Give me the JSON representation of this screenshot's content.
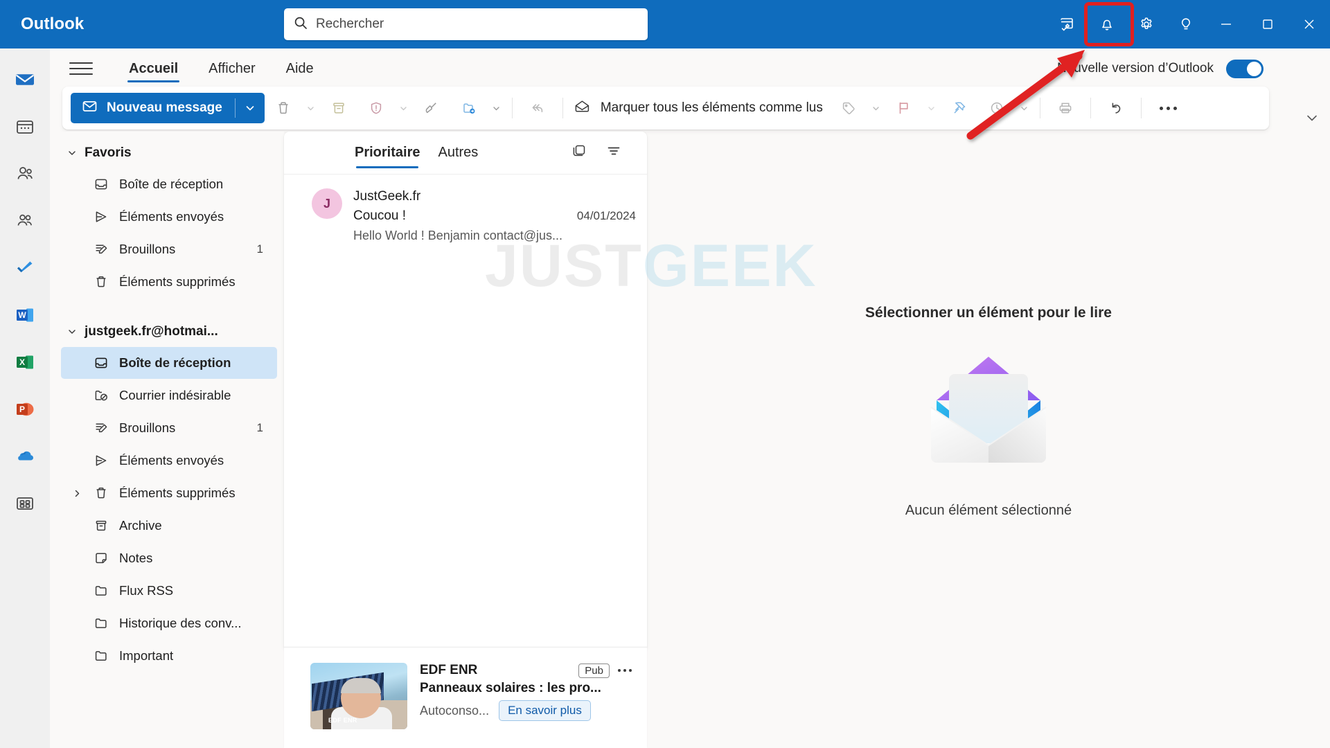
{
  "titlebar": {
    "brand": "Outlook",
    "search_placeholder": "Rechercher",
    "icons": [
      {
        "name": "todo-checkbox-icon",
        "label": "À faire"
      },
      {
        "name": "bell-icon",
        "label": "Notifications"
      },
      {
        "name": "gear-icon",
        "label": "Paramètres"
      },
      {
        "name": "lightbulb-icon",
        "label": "Conseils"
      }
    ],
    "window_controls": [
      "minimize",
      "maximize",
      "close"
    ],
    "highlight_color": "#e02020",
    "accent_color": "#0f6cbd"
  },
  "ribbon": {
    "tabs": [
      {
        "label": "Accueil",
        "active": true
      },
      {
        "label": "Afficher",
        "active": false
      },
      {
        "label": "Aide",
        "active": false
      }
    ],
    "new_version_label": "Nouvelle version d’Outlook",
    "new_version_on": true
  },
  "commandbar": {
    "new_message_label": "Nouveau message",
    "mark_all_read_label": "Marquer tous les éléments comme lus",
    "icons": [
      "delete-icon",
      "archive-icon",
      "report-icon",
      "sweep-icon",
      "move-to-icon",
      "reply-all-icon",
      "categorize-icon",
      "flag-icon",
      "pin-icon",
      "snooze-icon",
      "print-icon",
      "undo-icon",
      "more-options-icon"
    ]
  },
  "rail": {
    "items": [
      {
        "name": "mail-icon",
        "label": "Courrier",
        "active": true
      },
      {
        "name": "calendar-icon",
        "label": "Calendrier",
        "active": false
      },
      {
        "name": "people-icon",
        "label": "Contacts",
        "active": false
      },
      {
        "name": "groups-icon",
        "label": "Groupes",
        "active": false
      },
      {
        "name": "todo-icon",
        "label": "To Do",
        "active": false
      },
      {
        "name": "word-icon",
        "label": "Word",
        "active": false
      },
      {
        "name": "excel-icon",
        "label": "Excel",
        "active": false
      },
      {
        "name": "powerpoint-icon",
        "label": "PowerPoint",
        "active": false
      },
      {
        "name": "onedrive-icon",
        "label": "OneDrive",
        "active": false
      },
      {
        "name": "apps-icon",
        "label": "Applications",
        "active": false
      }
    ]
  },
  "folders": {
    "favorites": {
      "title": "Favoris",
      "items": [
        {
          "label": "Boîte de réception",
          "icon": "inbox-icon",
          "count": ""
        },
        {
          "label": "Éléments envoyés",
          "icon": "send-icon",
          "count": ""
        },
        {
          "label": "Brouillons",
          "icon": "draft-icon",
          "count": "1"
        },
        {
          "label": "Éléments supprimés",
          "icon": "trash-icon",
          "count": ""
        }
      ]
    },
    "account": {
      "title": "justgeek.fr@hotmai...",
      "items": [
        {
          "label": "Boîte de réception",
          "icon": "inbox-icon",
          "count": "",
          "selected": true,
          "twisty": false
        },
        {
          "label": "Courrier indésirable",
          "icon": "junk-icon",
          "count": "",
          "selected": false,
          "twisty": false
        },
        {
          "label": "Brouillons",
          "icon": "draft-icon",
          "count": "1",
          "selected": false,
          "twisty": false
        },
        {
          "label": "Éléments envoyés",
          "icon": "send-icon",
          "count": "",
          "selected": false,
          "twisty": false
        },
        {
          "label": "Éléments supprimés",
          "icon": "trash-icon",
          "count": "",
          "selected": false,
          "twisty": true
        },
        {
          "label": "Archive",
          "icon": "archive-icon",
          "count": "",
          "selected": false,
          "twisty": false
        },
        {
          "label": "Notes",
          "icon": "notes-icon",
          "count": "",
          "selected": false,
          "twisty": false
        },
        {
          "label": "Flux RSS",
          "icon": "folder-icon",
          "count": "",
          "selected": false,
          "twisty": false
        },
        {
          "label": "Historique des conv...",
          "icon": "folder-icon",
          "count": "",
          "selected": false,
          "twisty": false
        },
        {
          "label": "Important",
          "icon": "folder-icon",
          "count": "",
          "selected": false,
          "twisty": false
        }
      ]
    }
  },
  "message_list": {
    "tabs": [
      {
        "label": "Prioritaire",
        "active": true
      },
      {
        "label": "Autres",
        "active": false
      }
    ],
    "tools": [
      "conversation-view-icon",
      "filter-icon"
    ],
    "messages": [
      {
        "avatar_initial": "J",
        "avatar_color": "#f3c5e0",
        "sender": "JustGeek.fr",
        "subject": "Coucou !",
        "date": "04/01/2024",
        "preview": "Hello World ! Benjamin contact@jus..."
      }
    ]
  },
  "ad": {
    "advertiser": "EDF ENR",
    "badge": "Pub",
    "title": "Panneaux solaires : les pro...",
    "subtitle": "Autoconso...",
    "cta": "En savoir plus",
    "image_logo": "EDF ENR"
  },
  "reading_pane": {
    "title": "Sélectionner un élément pour le lire",
    "subtitle": "Aucun élément sélectionné",
    "illustration": "open-envelope-illustration"
  },
  "watermark": {
    "part1": "JUST",
    "part2": "GEEK"
  }
}
